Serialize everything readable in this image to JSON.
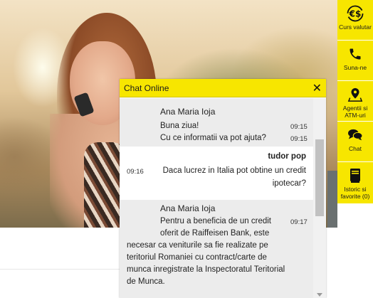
{
  "sidebar": {
    "items": [
      {
        "label": "Curs valutar",
        "icon": "currency-exchange-icon"
      },
      {
        "label": "Suna-ne",
        "icon": "phone-icon"
      },
      {
        "label": "Agentii si ATM-uri",
        "icon": "location-pin-icon"
      },
      {
        "label": "Chat",
        "icon": "chat-bubbles-icon"
      },
      {
        "label": "Istoric si favorite (0)",
        "icon": "book-icon"
      }
    ]
  },
  "chat": {
    "title": "Chat Online",
    "close_icon": "close-icon",
    "messages": [
      {
        "sender": "Ana Maria Ioja",
        "type": "agent",
        "lines": [
          "Buna ziua!",
          "Cu ce informatii va pot ajuta?"
        ],
        "times": [
          "09:15",
          "09:15"
        ]
      },
      {
        "sender": "tudor pop",
        "type": "user",
        "time": "09:16",
        "lines": [
          "Daca lucrez in Italia pot obtine un credit",
          "ipotecar?"
        ]
      },
      {
        "sender": "Ana Maria Ioja",
        "type": "agent",
        "time": "09:17",
        "lines": [
          "Pentru a beneficia de un credit",
          "oferit de Raiffeisen Bank, este",
          "necesar ca veniturile sa fie realizate pe",
          "teritoriul Romaniei cu contract/carte de",
          "munca inregistrate la Inspectoratul Teritorial",
          "de Munca."
        ]
      }
    ]
  },
  "colors": {
    "accent": "#f7e600",
    "agent_bg": "#ececec"
  }
}
